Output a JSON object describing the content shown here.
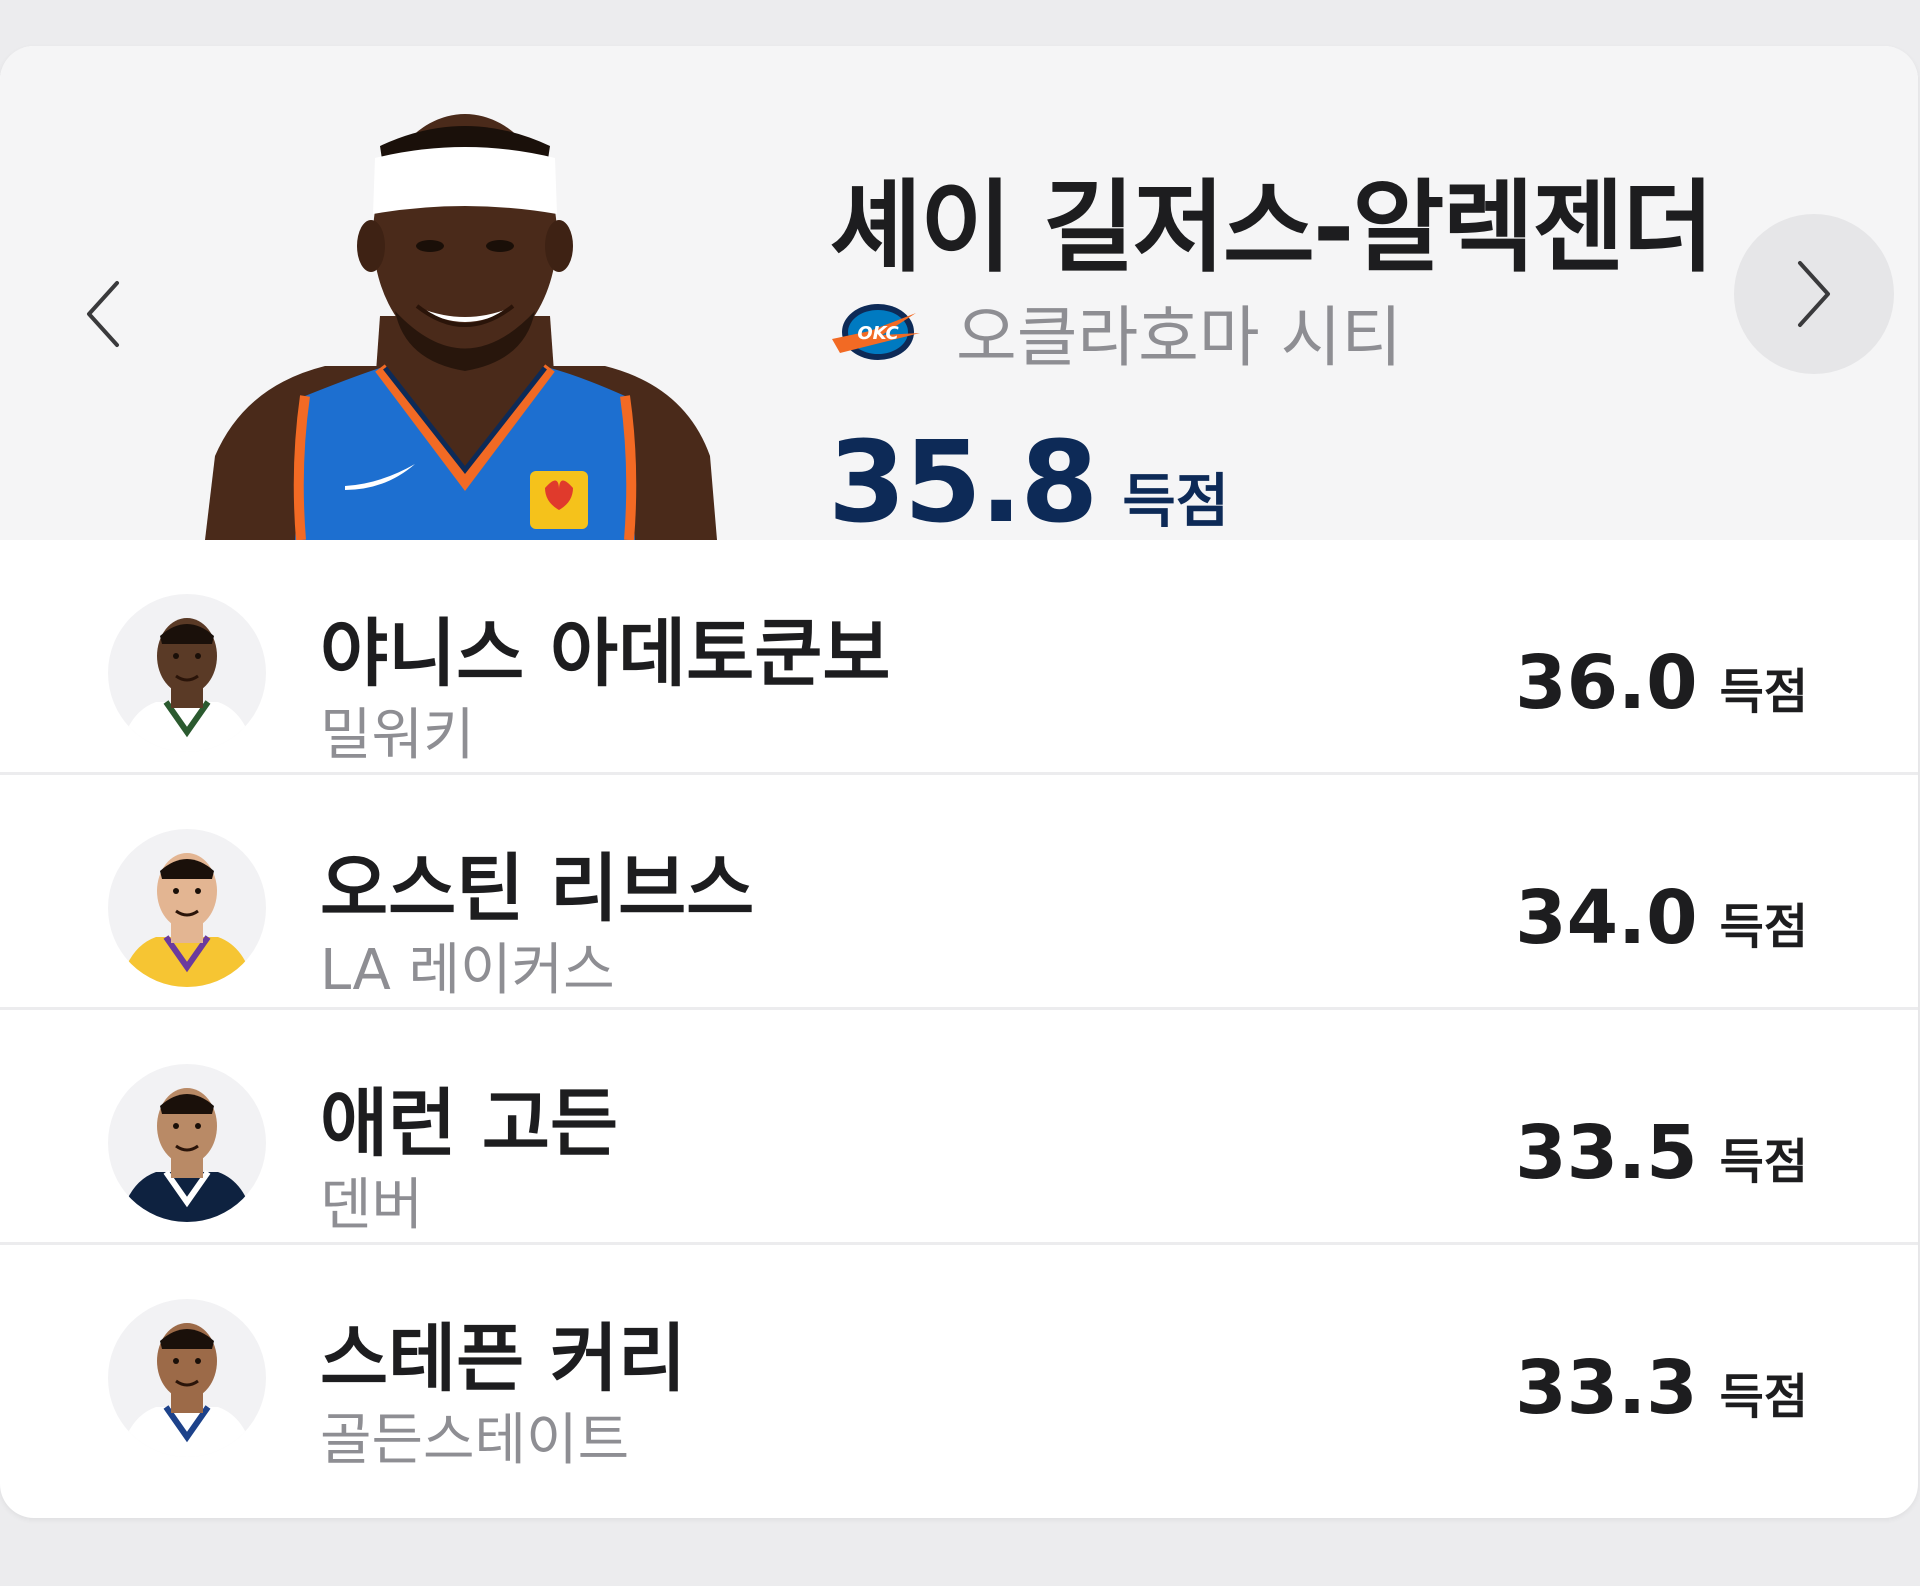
{
  "featured": {
    "name": "셰이 길저스-알렉젠더",
    "team": "오클라호마 시티",
    "team_logo_icon": "okc-thunder-logo-icon",
    "value": "35.8",
    "unit": "득점",
    "jersey_color": "#1d6fd0"
  },
  "nav": {
    "prev_icon": "chevron-left-icon",
    "next_icon": "chevron-right-icon"
  },
  "players": [
    {
      "name": "야니스 아데토쿤보",
      "team": "밀워키",
      "value": "36.0",
      "unit": "득점",
      "jersey_color": "#ffffff",
      "trim_color": "#2b5a2f",
      "skin": "#5a3a26"
    },
    {
      "name": "오스틴 리브스",
      "team": "LA 레이커스",
      "value": "34.0",
      "unit": "득점",
      "jersey_color": "#f6c533",
      "trim_color": "#6b3a9e",
      "skin": "#e3b592"
    },
    {
      "name": "애런 고든",
      "team": "덴버",
      "value": "33.5",
      "unit": "득점",
      "jersey_color": "#0e2240",
      "trim_color": "#ffffff",
      "skin": "#b98a66"
    },
    {
      "name": "스테픈 커리",
      "team": "골든스테이트",
      "value": "33.3",
      "unit": "득점",
      "jersey_color": "#ffffff",
      "trim_color": "#1d428a",
      "skin": "#9c6a48"
    }
  ]
}
